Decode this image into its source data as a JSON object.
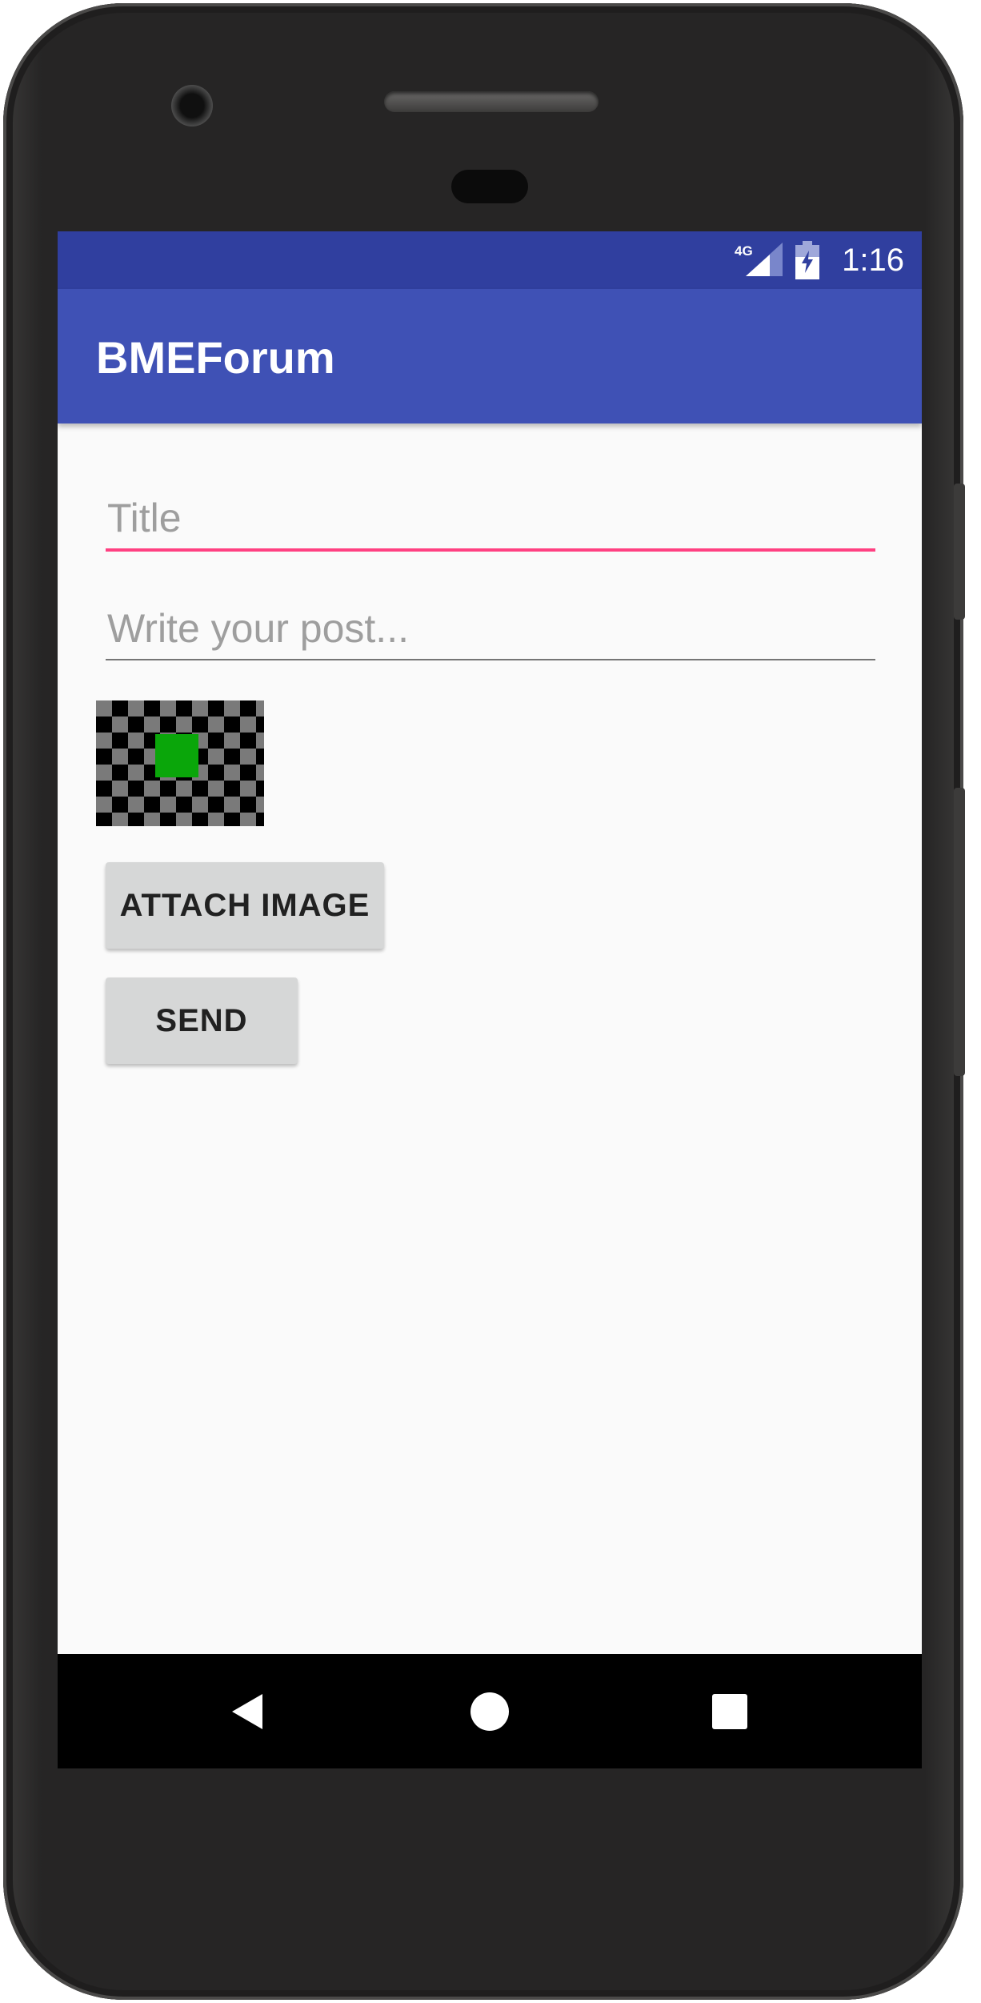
{
  "status_bar": {
    "network": "4G",
    "time": "1:16"
  },
  "app_bar": {
    "title": "BMEForum"
  },
  "form": {
    "title_input": {
      "value": "",
      "placeholder": "Title"
    },
    "post_input": {
      "value": "",
      "placeholder": "Write your post..."
    },
    "attach_button_label": "ATTACH IMAGE",
    "send_button_label": "SEND"
  },
  "icons": {
    "signal": "signal-4g-icon",
    "battery": "battery-charging-icon",
    "back": "back-triangle-icon",
    "home": "home-circle-icon",
    "recents": "recents-square-icon",
    "image_preview": "image-placeholder-checkerboard"
  },
  "colors": {
    "status_bar": "#303f9f",
    "app_bar": "#3f51b5",
    "accent": "#ff4081",
    "background": "#fafafa",
    "button": "#d6d7d7",
    "image_center": "#0aa60a"
  }
}
